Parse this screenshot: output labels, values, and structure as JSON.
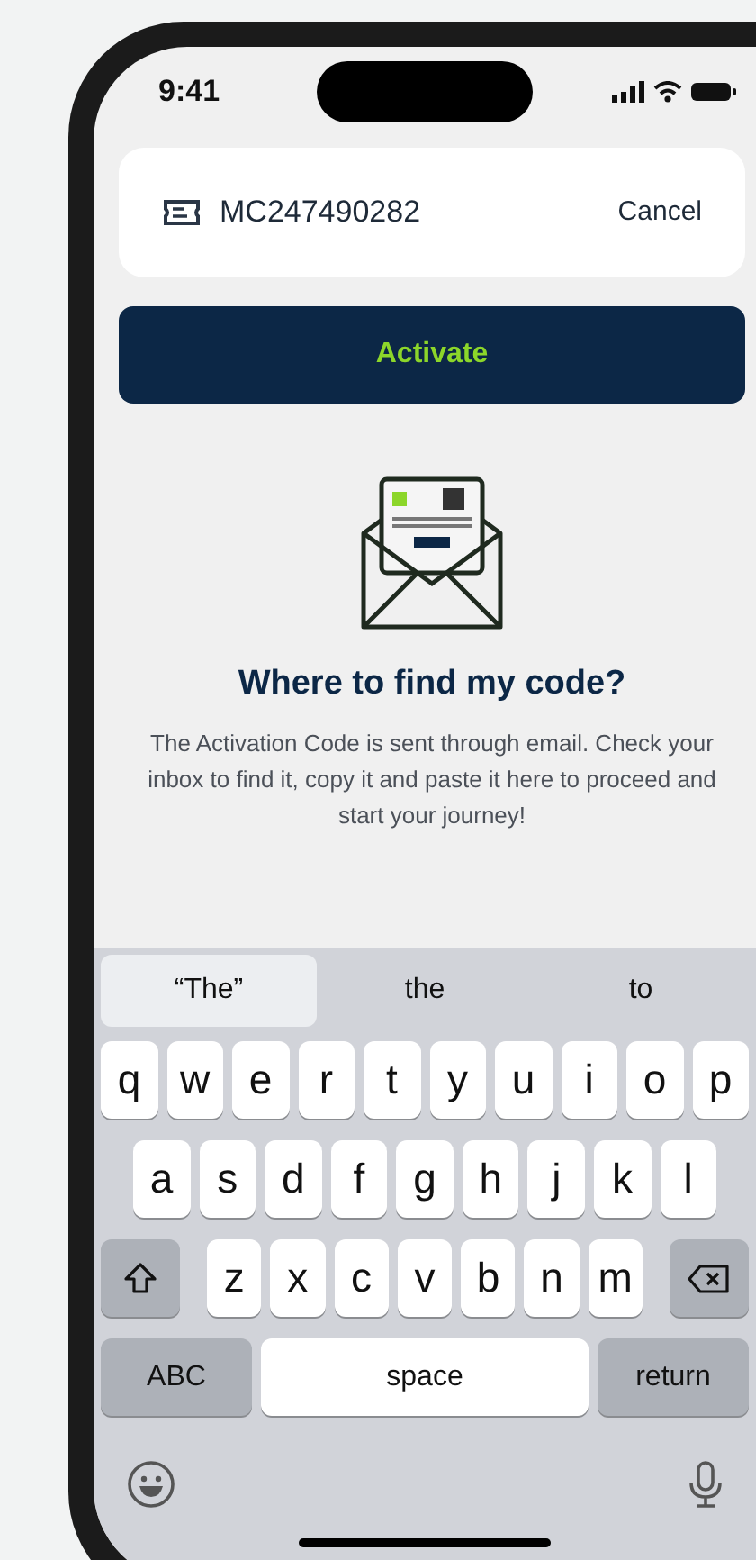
{
  "status_bar": {
    "time": "9:41"
  },
  "code_card": {
    "code": "MC247490282",
    "cancel": "Cancel"
  },
  "activate_button": {
    "label": "Activate"
  },
  "heading": "Where to find my code?",
  "description": "The Activation Code is sent through email. Check your inbox to find it, copy it and paste it here to proceed and start your journey!",
  "keyboard": {
    "suggestions": [
      {
        "label": "“The”",
        "selected": true
      },
      {
        "label": "the",
        "selected": false
      },
      {
        "label": "to",
        "selected": false
      }
    ],
    "rows": [
      [
        {
          "kind": "letter",
          "label": "q"
        },
        {
          "kind": "letter",
          "label": "w"
        },
        {
          "kind": "letter",
          "label": "e"
        },
        {
          "kind": "letter",
          "label": "r"
        },
        {
          "kind": "letter",
          "label": "t"
        },
        {
          "kind": "letter",
          "label": "y"
        },
        {
          "kind": "letter",
          "label": "u"
        },
        {
          "kind": "letter",
          "label": "i"
        },
        {
          "kind": "letter",
          "label": "o"
        },
        {
          "kind": "letter",
          "label": "p"
        }
      ],
      [
        {
          "kind": "letter",
          "label": "a"
        },
        {
          "kind": "letter",
          "label": "s"
        },
        {
          "kind": "letter",
          "label": "d"
        },
        {
          "kind": "letter",
          "label": "f"
        },
        {
          "kind": "letter",
          "label": "g"
        },
        {
          "kind": "letter",
          "label": "h"
        },
        {
          "kind": "letter",
          "label": "j"
        },
        {
          "kind": "letter",
          "label": "k"
        },
        {
          "kind": "letter",
          "label": "l"
        }
      ],
      [
        {
          "kind": "shift"
        },
        {
          "kind": "letter",
          "label": "z"
        },
        {
          "kind": "letter",
          "label": "x"
        },
        {
          "kind": "letter",
          "label": "c"
        },
        {
          "kind": "letter",
          "label": "v"
        },
        {
          "kind": "letter",
          "label": "b"
        },
        {
          "kind": "letter",
          "label": "n"
        },
        {
          "kind": "letter",
          "label": "m"
        },
        {
          "kind": "backspace"
        }
      ]
    ],
    "bottom_row": [
      {
        "kind": "mode",
        "label": "ABC"
      },
      {
        "kind": "space",
        "label": "space"
      },
      {
        "kind": "return",
        "label": "return"
      }
    ]
  }
}
